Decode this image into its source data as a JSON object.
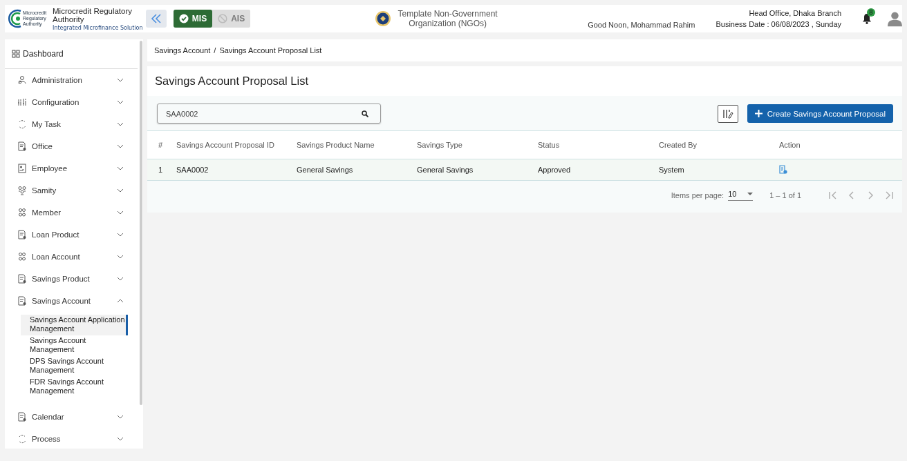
{
  "header": {
    "logo_text": "Microcredit Regulatory Authority",
    "title": "Microcredit Regulatory Authority",
    "subtitle": "Integrated Microfinance Solution",
    "modes": [
      {
        "label": "MIS",
        "selected": true
      },
      {
        "label": "AIS",
        "selected": false
      }
    ],
    "org_name": "Template Non-Government Organization (NGOs)",
    "greeting": "Good Noon, Mohammad Rahim",
    "office": "Head Office, Dhaka Branch",
    "business_date": "Business Date : 06/08/2023 , Sunday",
    "notification_count": "8"
  },
  "sidebar": {
    "dashboard": "Dashboard",
    "items": [
      {
        "label": "Administration",
        "expanded": false
      },
      {
        "label": "Configuration",
        "expanded": false
      },
      {
        "label": "My Task",
        "expanded": false
      },
      {
        "label": "Office",
        "expanded": false
      },
      {
        "label": "Employee",
        "expanded": false
      },
      {
        "label": "Samity",
        "expanded": false
      },
      {
        "label": "Member",
        "expanded": false
      },
      {
        "label": "Loan Product",
        "expanded": false
      },
      {
        "label": "Loan Account",
        "expanded": false
      },
      {
        "label": "Savings Product",
        "expanded": false
      },
      {
        "label": "Savings Account",
        "expanded": true,
        "children": [
          {
            "label": "Savings Account Application Management",
            "selected": true
          },
          {
            "label": "Savings Account Management",
            "selected": false
          },
          {
            "label": "DPS Savings Account Management",
            "selected": false
          },
          {
            "label": "FDR Savings Account Management",
            "selected": false
          }
        ]
      },
      {
        "label": "Calendar",
        "expanded": false
      },
      {
        "label": "Process",
        "expanded": false
      }
    ]
  },
  "breadcrumb": {
    "items": [
      "Savings Account",
      "Savings Account Proposal List"
    ],
    "separator": "/"
  },
  "page_title": "Savings Account Proposal List",
  "search": {
    "value": "SAA0002"
  },
  "create_button": "Create Savings Account Proposal",
  "table": {
    "columns": [
      "#",
      "Savings Account Proposal ID",
      "Savings Product Name",
      "Savings Type",
      "Status",
      "Created By",
      "Action"
    ],
    "rows": [
      {
        "cells": [
          "1",
          "SAA0002",
          "General Savings",
          "General Savings",
          "Approved",
          "System"
        ]
      }
    ]
  },
  "paginator": {
    "label": "Items per page:",
    "page_size": "10",
    "range": "1 – 1 of 1"
  }
}
